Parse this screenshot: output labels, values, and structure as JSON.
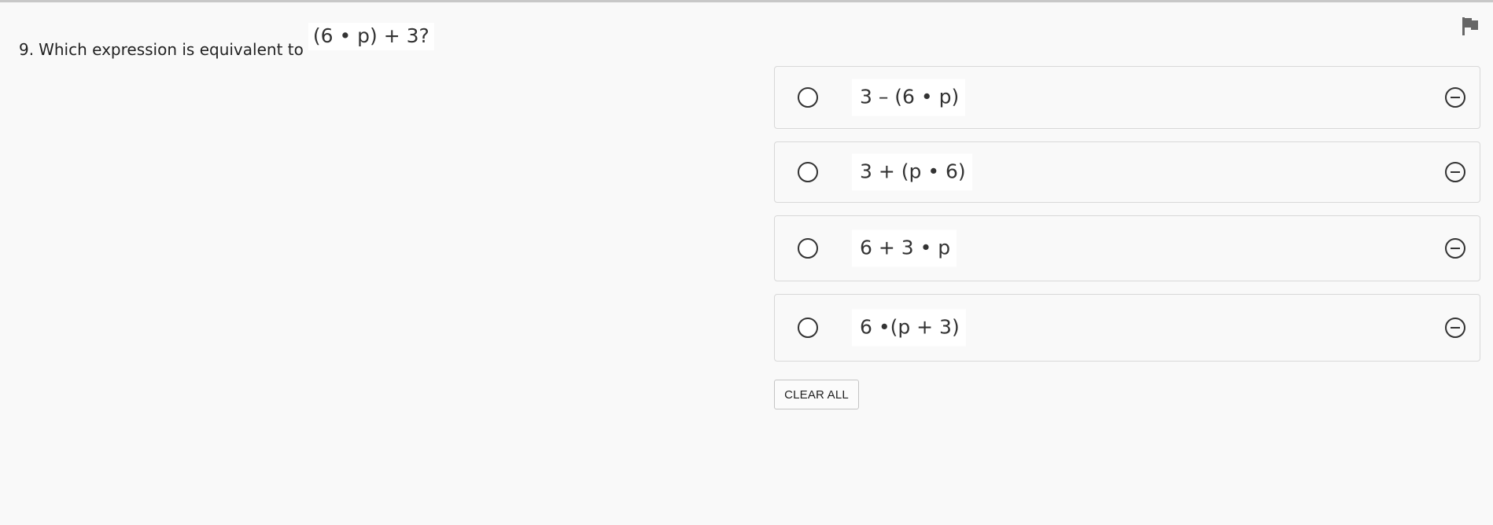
{
  "question": {
    "number": "9.",
    "text": "Which expression is equivalent to",
    "expression": "(6 • p) + 3?"
  },
  "options": [
    {
      "expression": "3 – (6 • p)"
    },
    {
      "expression": "3 + (p • 6)"
    },
    {
      "expression": "6 + 3 • p"
    },
    {
      "expression": "6 •(p + 3)"
    }
  ],
  "actions": {
    "clear_all_label": "CLEAR ALL"
  },
  "icons": {
    "flag": "flag-icon",
    "radio": "radio-button-icon",
    "eliminate": "minus-circle-icon"
  },
  "colors": {
    "background": "#f9f9f9",
    "text": "#222222",
    "border": "#d8d8d8",
    "flag": "#666666"
  }
}
